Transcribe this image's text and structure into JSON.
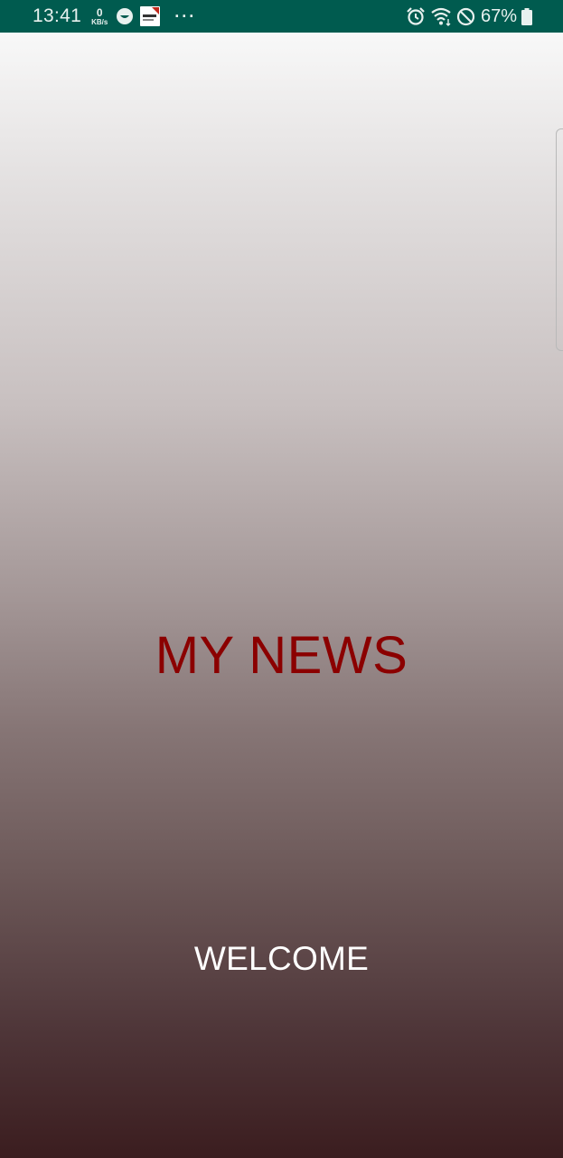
{
  "status_bar": {
    "time": "13:41",
    "net_speed_value": "0",
    "net_speed_unit": "KB/s",
    "more_indicator": "···",
    "battery_percent": "67%",
    "background_color": "#005b4f",
    "icons": [
      "smile-icon",
      "app-thumbnail-icon",
      "alarm-icon",
      "wifi-icon",
      "do-not-disturb-icon",
      "battery-icon"
    ]
  },
  "splash": {
    "title": "MY NEWS",
    "subtitle": "WELCOME",
    "title_color": "#8b0000",
    "subtitle_color": "#ffffff",
    "gradient_top": "#f8f8f8",
    "gradient_bottom": "#3b1d1f"
  }
}
